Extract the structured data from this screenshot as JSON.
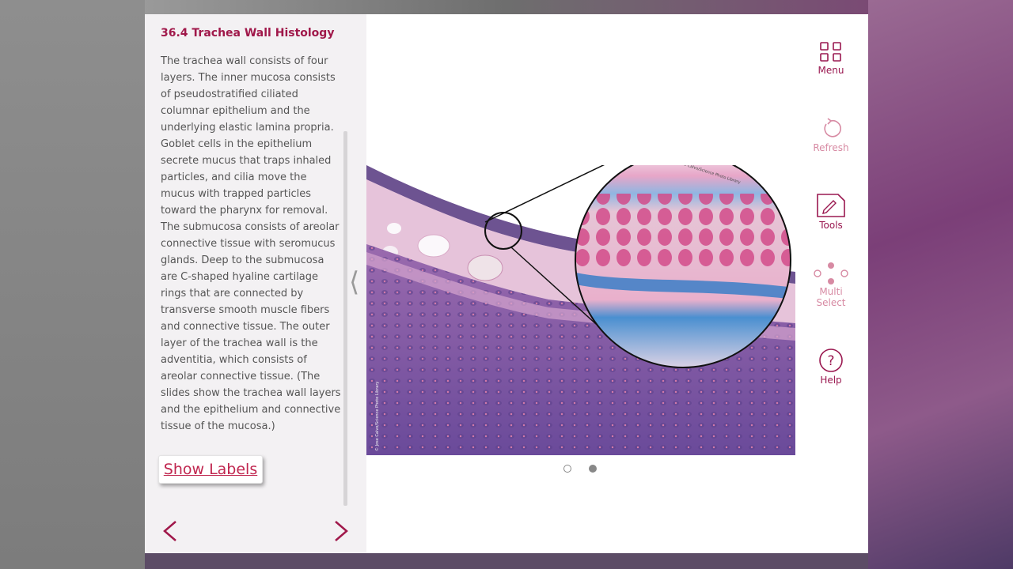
{
  "section": {
    "title": "36.4 Trachea Wall Histology",
    "body": "The trachea wall consists of four layers. The inner mucosa consists of pseudostratified ciliated columnar epithelium and the underlying elastic lamina propria. Goblet cells in the epithelium secrete mucus that traps inhaled particles, and cilia move the mucus with trapped particles toward the pharynx for removal. The submucosa consists of areolar connective tissue with seromucus glands. Deep to the submucosa are C-shaped hyaline cartilage rings that are connected by transverse smooth muscle fibers and connective tissue. The outer layer of the trachea wall is the adventitia, which consists of areolar connective tissue. (The slides show the trachea wall layers and the epithelium and connective tissue of the mucosa.)"
  },
  "show_labels_button": "Show Labels",
  "image": {
    "credit_main": "© Jose Calvo/Science Photo Library",
    "credit_inset": "© Jose Calvo/Science Photo Library"
  },
  "pager": {
    "total": 2,
    "current": 2
  },
  "toolbar": {
    "menu": "Menu",
    "refresh": "Refresh",
    "tools": "Tools",
    "multi_select_line1": "Multi",
    "multi_select_line2": "Select",
    "help": "Help"
  },
  "icons": {
    "menu": "grid-icon",
    "refresh": "refresh-icon",
    "tools": "pencil-note-icon",
    "multi_select": "dots-icon",
    "help": "question-icon",
    "prev": "chevron-left-icon",
    "next": "chevron-right-icon",
    "collapse": "collapse-chevron-icon"
  },
  "colors": {
    "accent": "#9a1850",
    "accent_disabled": "#d78aa3",
    "title": "#a0184a",
    "link": "#c0264f"
  }
}
